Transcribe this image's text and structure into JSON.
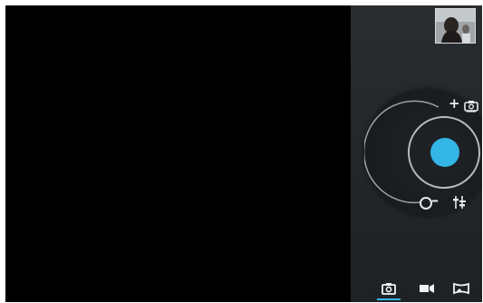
{
  "app": {
    "name": "Camera"
  },
  "viewfinder": {
    "state": "black"
  },
  "thumbnail": {
    "icon": "gallery-thumbnail"
  },
  "dial": {
    "zoom_in_icon": "plus-icon",
    "switch_camera_icon": "switch-camera-icon",
    "zoom_out_icon": "minus-icon",
    "settings_icon": "sliders-icon",
    "shutter_color": "#33b5e5"
  },
  "modes": {
    "items": [
      {
        "id": "photo",
        "icon": "camera-icon",
        "selected": true
      },
      {
        "id": "video",
        "icon": "video-camera-icon",
        "selected": false
      },
      {
        "id": "panorama",
        "icon": "panorama-icon",
        "selected": false
      }
    ],
    "accent": "#33b5e5"
  }
}
